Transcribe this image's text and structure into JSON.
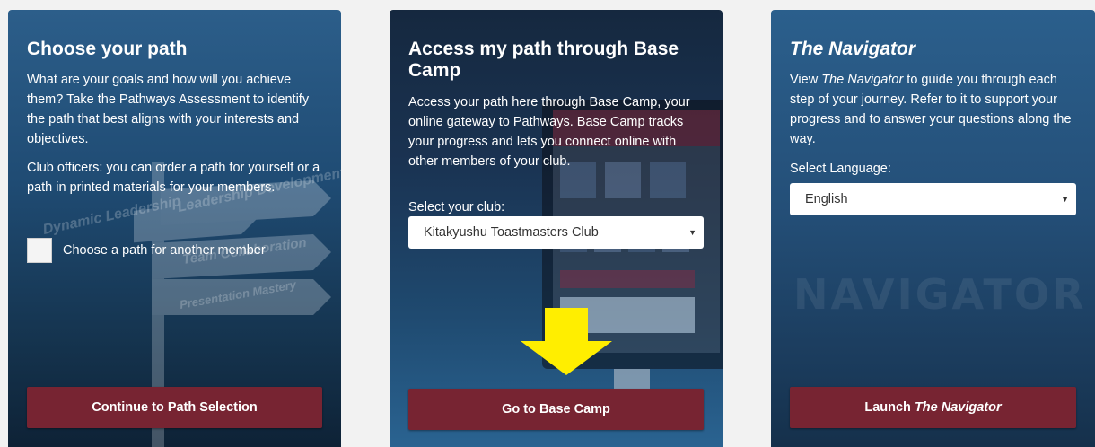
{
  "cards": {
    "path": {
      "title": "Choose your path",
      "description": "What are your goals and how will you achieve them? Take the Pathways Assessment to identify the path that best aligns with your interests and objectives.",
      "officers_note": "Club officers: you can order a path for yourself or a path in printed materials for your members.",
      "checkbox_label": "Choose a path for another member",
      "button_label": "Continue to Path Selection",
      "sign_words": [
        "Dynamic Leadership",
        "Leadership Development",
        "Team Collaboration",
        "Presentation Mastery"
      ]
    },
    "basecamp": {
      "title": "Access my path through Base Camp",
      "description": "Access your path here through Base Camp, your online gateway to Pathways. Base Camp tracks your progress and lets you connect online with other members of your club.",
      "select_label": "Select your club:",
      "select_value": "Kitakyushu Toastmasters Club",
      "button_label": "Go to Base Camp"
    },
    "navigator": {
      "title": "The Navigator",
      "desc_before": "View ",
      "desc_italic": "The Navigator",
      "desc_after": " to guide you through each step of your journey. Refer to it to support your progress and to answer your questions along the way.",
      "select_label": "Select Language:",
      "select_value": "English",
      "button_before": "Launch ",
      "button_italic": "The Navigator",
      "watermark": "NAVIGATOR"
    }
  },
  "icons": {
    "dropdown": "chevron-down-icon",
    "annotation": "arrow-down-icon"
  },
  "colors": {
    "button": "#772432",
    "annotation_arrow": "#ffee00"
  }
}
